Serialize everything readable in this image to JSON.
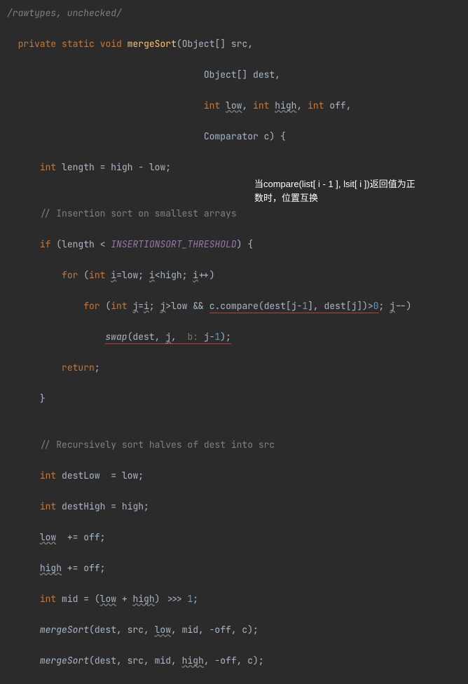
{
  "code": {
    "cmt_suppress": "/rawtypes, unchecked/",
    "kw_private": "private",
    "kw_static": "static",
    "kw_void": "void",
    "m_mergeSort": "mergeSort",
    "t_ObjArr": "Object[]",
    "t_Object": "Object",
    "p_src": "src",
    "p_dest": "dest",
    "t_int": "int",
    "p_low": "low",
    "p_high": "high",
    "p_off": "off",
    "t_Comparator": "Comparator",
    "p_c": "c",
    "v_length": "length",
    "op_assignExpr": " = high - low;",
    "cmt_insertion": "// Insertion sort on smallest arrays",
    "kw_if": "if",
    "const_INSERTION": "INSERTIONSORT_THRESHOLD",
    "kw_for": "for",
    "v_i": "i",
    "v_j": "j",
    "compare_call": "c.compare(dest[j-",
    "num_1a": "1",
    "compare_mid": "], dest[j])>",
    "num_0": "0",
    "swap": "swap",
    "swap_open": "(dest, ",
    "swap_j": "j",
    "swap_comma": ",  ",
    "hint_b": "b: ",
    "swap_expr": "j-",
    "num_1b": "1",
    "swap_close": ");",
    "kw_return": "return",
    "cmt_recursive": "// Recursively sort halves of dest into src",
    "v_destLow": "destLow",
    "eq_low": "  = low;",
    "v_destHigh": "destHigh",
    "eq_high": " = high;",
    "pe_off1": "  += off;",
    "pe_off2": " += off;",
    "v_mid": "mid",
    "mid_expr_pre": " = (",
    "mid_plus": " + ",
    "mid_shift": ") >>> ",
    "num_1c": "1",
    "ms_args1_pre": "(dest, src, ",
    "ms_args1_post": ", mid, -off, c);",
    "ms_args2_pre": "(dest, src, mid, ",
    "ms_args2_post": ", -off, c);"
  },
  "note": {
    "line1": "当compare(list[ i - 1 ], lsit[ i ])返回值为正",
    "line2": "数时，位置互换"
  },
  "chart_data": null
}
